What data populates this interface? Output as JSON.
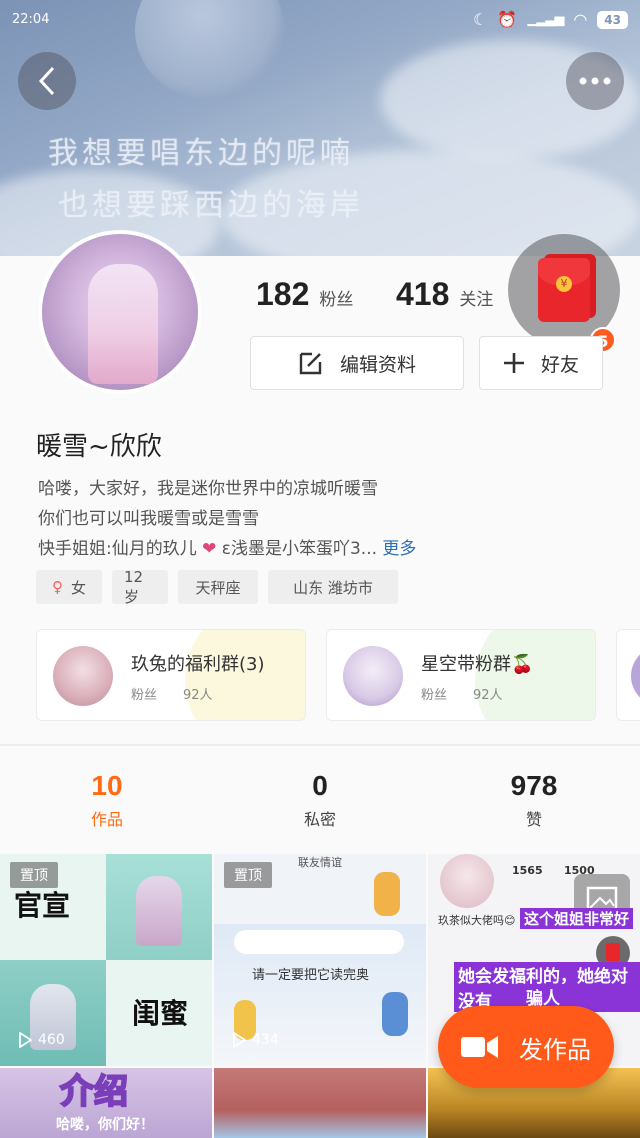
{
  "status": {
    "time": "22:04",
    "battery": "43"
  },
  "banner": {
    "line1": "我想要唱东边的呢喃",
    "line2": "也想要踩西边的海岸"
  },
  "profile": {
    "fans_count": "182",
    "fans_label": "粉丝",
    "follow_count": "418",
    "follow_label": "关注",
    "edit_label": "编辑资料",
    "friend_label": "好友",
    "redpacket_badge": "5",
    "username": "暖雪~欣欣",
    "bio_line1": "哈喽，大家好，我是迷你世界中的凉城听暖雪",
    "bio_line2": "你们也可以叫我暖雪或是雪雪",
    "bio_line3a": "快手姐姐:仙月的玖儿",
    "bio_line3b": "ε浅墨是小笨蛋吖3...",
    "bio_more": "更多",
    "tags": [
      "女",
      "12岁",
      "天秤座",
      "山东 潍坊市"
    ]
  },
  "groups": [
    {
      "name": "玖兔的福利群(3)",
      "fans_label": "粉丝",
      "count": "92人"
    },
    {
      "name": "星空带粉群🍒",
      "fans_label": "粉丝",
      "count": "92人"
    }
  ],
  "tabs": [
    {
      "num": "10",
      "label": "作品"
    },
    {
      "num": "0",
      "label": "私密"
    },
    {
      "num": "978",
      "label": "赞"
    }
  ],
  "grid": {
    "pin_label": "置顶",
    "cell1": {
      "top_text": "官宣",
      "bottom_text": "闺蜜",
      "plays": "460"
    },
    "cell2": {
      "top_text": "联友情谊",
      "mid_text": "请一定要把它读完奥",
      "plays": "434"
    },
    "cell3": {
      "stat1": "1565",
      "stat2": "1500",
      "line1": "玖茶似大佬吗😊",
      "hl1": "这个姐姐非常好",
      "hl2": "她会发福利的，她绝对没有",
      "hl3": "骗人"
    },
    "cell4": {
      "text": "介绍",
      "sub": "哈喽，你们好！"
    }
  },
  "fab_label": "发作品",
  "colors": {
    "accent": "#ff6a13",
    "fab": "#ff5a1a",
    "link": "#2f6db3"
  }
}
